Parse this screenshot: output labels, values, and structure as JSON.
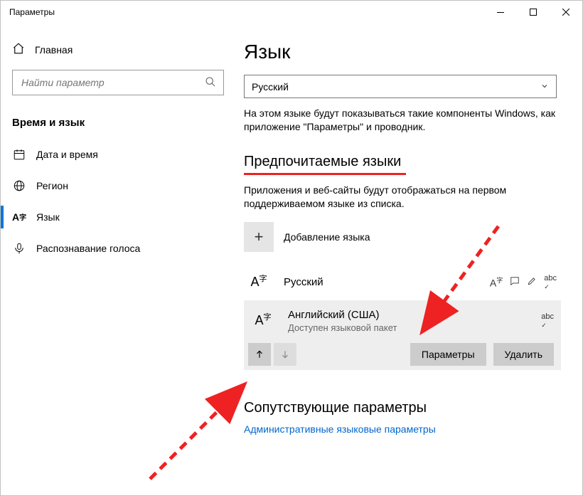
{
  "window": {
    "title": "Параметры"
  },
  "sidebar": {
    "home": "Главная",
    "search_placeholder": "Найти параметр",
    "section": "Время и язык",
    "items": [
      {
        "label": "Дата и время"
      },
      {
        "label": "Регион"
      },
      {
        "label": "Язык"
      },
      {
        "label": "Распознавание голоса"
      }
    ]
  },
  "main": {
    "title": "Язык",
    "display_language": {
      "selected": "Русский",
      "description": "На этом языке будут показываться такие компоненты Windows, как приложение \"Параметры\" и проводник."
    },
    "preferred": {
      "heading": "Предпочитаемые языки",
      "description": "Приложения и веб-сайты будут отображаться на первом поддерживаемом языке из списка.",
      "add_label": "Добавление языка",
      "languages": [
        {
          "name": "Русский",
          "selected": false,
          "features": [
            "text-to-speech",
            "speech",
            "handwriting",
            "spellcheck"
          ]
        },
        {
          "name": "Английский (США)",
          "sub": "Доступен языковой пакет",
          "selected": true,
          "features": [
            "spellcheck"
          ]
        }
      ],
      "actions": {
        "options": "Параметры",
        "remove": "Удалить"
      }
    },
    "related": {
      "heading": "Сопутствующие параметры",
      "link": "Административные языковые параметры"
    }
  }
}
